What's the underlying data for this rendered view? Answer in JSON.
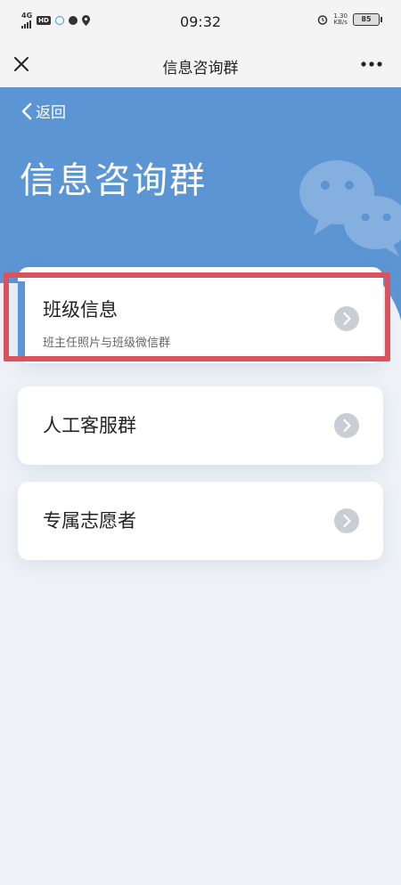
{
  "status_bar": {
    "signal": "4G",
    "hd": "HD",
    "time": "09:32",
    "net_speed_value": "1.30",
    "net_speed_unit": "KB/s",
    "battery": "85"
  },
  "nav": {
    "title": "信息咨询群"
  },
  "hero": {
    "back_label": "返回",
    "title": "信息咨询群"
  },
  "cards": [
    {
      "title": "班级信息",
      "subtitle": "班主任照片与班级微信群"
    },
    {
      "title": "人工客服群"
    },
    {
      "title": "专属志愿者"
    }
  ],
  "colors": {
    "header_blue": "#5b95d3",
    "highlight_red": "#d9535e",
    "page_background": "#eef2f6"
  },
  "icons": [
    "close-icon",
    "more-icon",
    "back-chevron-icon",
    "wechat-icon",
    "chevron-right-icon"
  ]
}
